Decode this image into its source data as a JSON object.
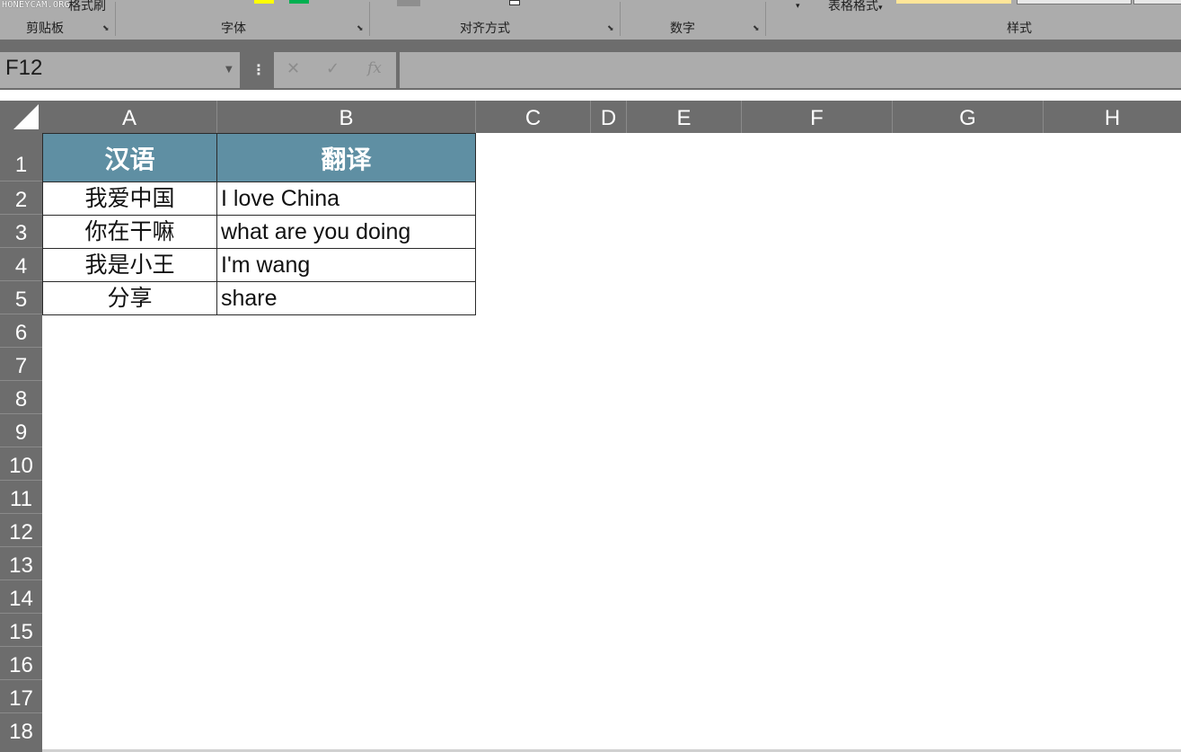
{
  "ribbon": {
    "watermark": "HONEYCAM.ORG",
    "format_painter_label": "格式刷",
    "table_format_label": "表格格式",
    "groups": [
      {
        "label": "剪贴板"
      },
      {
        "label": "字体"
      },
      {
        "label": "对齐方式"
      },
      {
        "label": "数字"
      },
      {
        "label": "样式"
      }
    ]
  },
  "formula_bar": {
    "name_box": "F12",
    "cancel_icon": "✕",
    "enter_icon": "✓",
    "fx_label": "fx",
    "formula_value": ""
  },
  "columns": [
    "A",
    "B",
    "C",
    "D",
    "E",
    "F",
    "G",
    "H"
  ],
  "rows": [
    "1",
    "2",
    "3",
    "4",
    "5",
    "6",
    "7",
    "8",
    "9",
    "10",
    "11",
    "12",
    "13",
    "14",
    "15",
    "16",
    "17",
    "18"
  ],
  "table": {
    "headers": [
      "汉语",
      "翻译"
    ],
    "data": [
      [
        "我爱中国",
        "I love China"
      ],
      [
        "你在干嘛",
        "what are you doing"
      ],
      [
        "我是小王",
        "I'm wang"
      ],
      [
        "分享",
        "share"
      ]
    ]
  },
  "colors": {
    "header_fill": "#5f8fa3",
    "chrome_dark": "#6d6d6d",
    "ribbon": "#acacac",
    "swatch_yellow": "#ffff00",
    "swatch_green": "#00b050"
  }
}
